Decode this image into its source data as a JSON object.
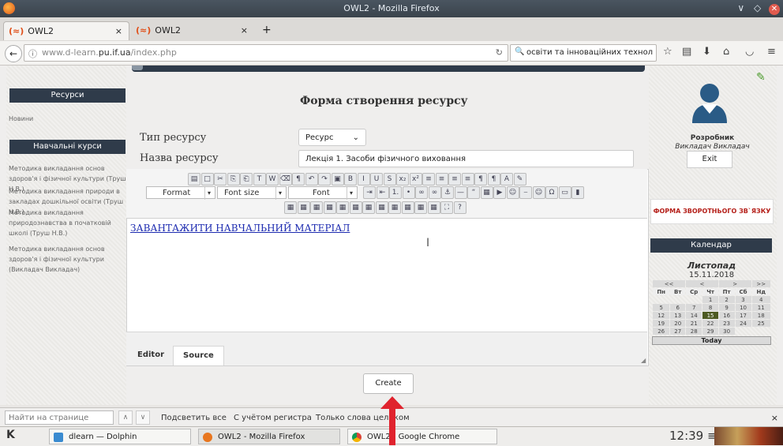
{
  "window": {
    "title": "OWL2 - Mozilla Firefox"
  },
  "tabs": [
    {
      "label": "OWL2",
      "close": "×"
    },
    {
      "label": "OWL2",
      "close": "×"
    }
  ],
  "newtab": "+",
  "nav": {
    "url_prefix": "www.d-learn.",
    "url_domain": "pu.if.ua",
    "url_path": "/index.php",
    "search_value": "освіти та інноваційних технологій →"
  },
  "left": {
    "resources_header": "Ресурси",
    "news_link": "Новини",
    "courses_header": "Навчальні курси",
    "courses": [
      "Методика викладання основ здоров'я і фізичної культури (Труш Н.В.)",
      "Методика викладання природи в закладах дошкільної освіти (Труш Н.В.)",
      "Методика викладання природознавства в початковій школі (Труш Н.В.)",
      "Методика викладання основ здоров'я і фізичної культури (Викладач Викладач)"
    ]
  },
  "form": {
    "title": "Форма створення ресурсу",
    "type_label": "Тип ресурсу",
    "type_value": "Ресурс",
    "name_label": "Назва ресурсу",
    "name_value": "Лекція 1. Засоби фізичного виховання",
    "editor_content": "ЗАВАНТАЖИТИ НАВЧАЛЬНИЙ МАТЕРІАЛ",
    "format_label": "Format",
    "fontsize_label": "Font size",
    "font_label": "Font",
    "editor_tab": "Editor",
    "source_tab": "Source",
    "create_button": "Create"
  },
  "right": {
    "role": "Розробник",
    "user": "Викладач  Викладач",
    "exit": "Exit",
    "feedback": "ФОРМА ЗВОРОТНЬОГО ЗВ`ЯЗКУ",
    "calendar_header": "Календар",
    "month": "Листопад",
    "date": "15.11.2018",
    "nav": [
      "<<",
      "<",
      ">",
      ">>"
    ],
    "weekdays": [
      "Пн",
      "Вт",
      "Ср",
      "Чт",
      "Пт",
      "Сб",
      "Нд"
    ],
    "weeks": [
      [
        "",
        "",
        "",
        "1",
        "2",
        "3",
        "4"
      ],
      [
        "5",
        "6",
        "7",
        "8",
        "9",
        "10",
        "11"
      ],
      [
        "12",
        "13",
        "14",
        "15",
        "16",
        "17",
        "18"
      ],
      [
        "19",
        "20",
        "21",
        "22",
        "23",
        "24",
        "25"
      ],
      [
        "26",
        "27",
        "28",
        "29",
        "30",
        "",
        ""
      ]
    ],
    "today_day": "15",
    "today_button": "Today"
  },
  "findbar": {
    "placeholder": "Найти на странице",
    "highlight": "Подсветить все",
    "match_case": "С учётом регистра",
    "whole_words": "Только слова целиком",
    "close": "×"
  },
  "taskbar": {
    "tasks": [
      "dlearn — Dolphin",
      "OWL2 - Mozilla Firefox",
      "OWL2 - Google Chrome"
    ],
    "clock": "12:39"
  },
  "colors": {
    "dark_header": "#2f3b4a",
    "link_blue": "#1d2bb0",
    "feedback_red": "#b5201a",
    "today_green": "#4d5a22",
    "arrow_red": "#e0232e"
  }
}
